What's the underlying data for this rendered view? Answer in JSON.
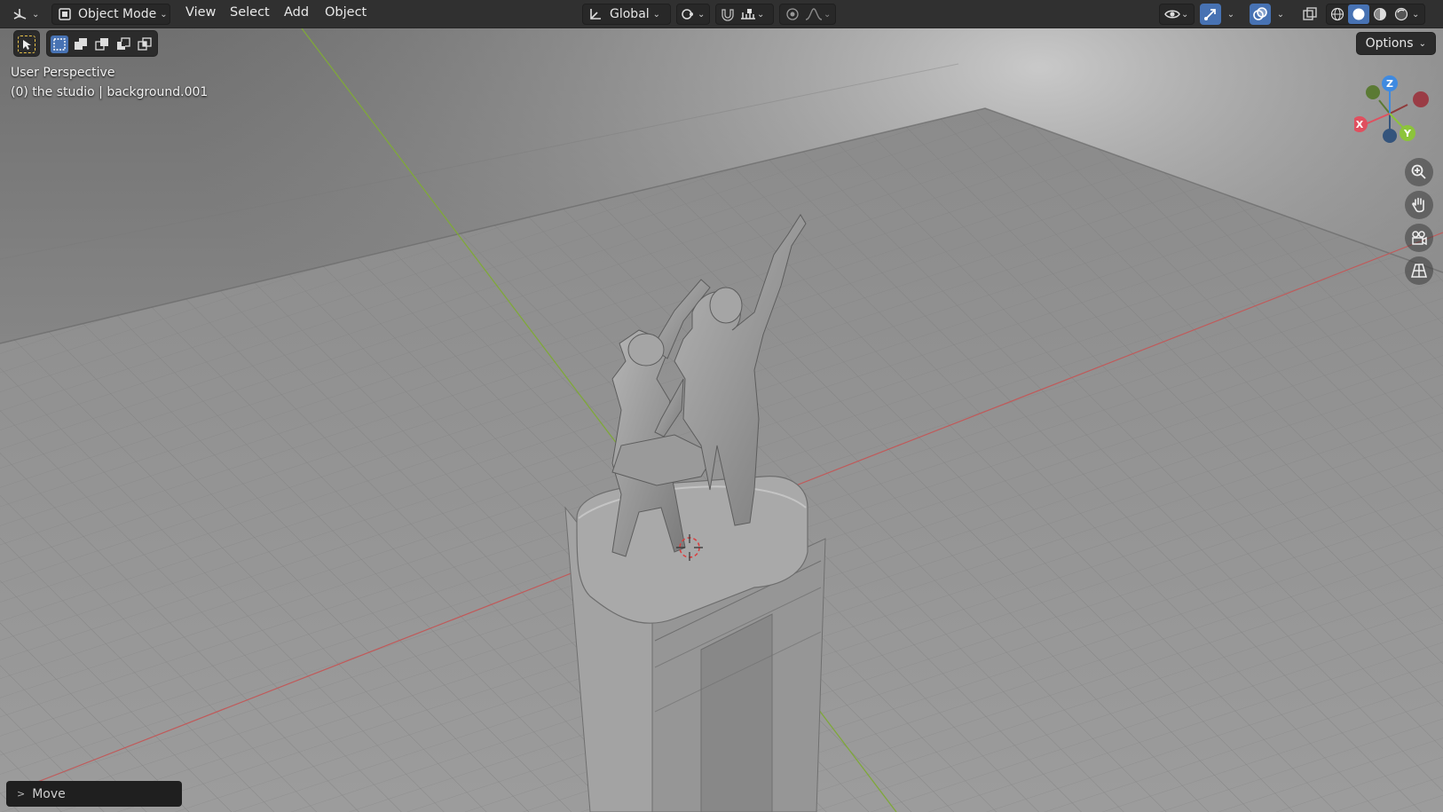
{
  "header": {
    "editor_type_icon": "3d-viewport-icon",
    "mode": {
      "label": "Object Mode",
      "icon": "object-mode-icon"
    },
    "menus": [
      "View",
      "Select",
      "Add",
      "Object"
    ],
    "transform_orientation": {
      "label": "Global",
      "icon": "orientation-global-icon"
    },
    "pivot_icon": "pivot-point-icon",
    "snap_icon": "snap-magnet-icon",
    "snap_target_icon": "snap-increment-icon",
    "proportional_icon": "proportional-edit-icon",
    "falloff_icon": "falloff-curve-icon",
    "visibility_icon": "eye-visibility-icon",
    "gizmo_icon": "gizmo-toggle-icon",
    "overlay_icon": "overlay-toggle-icon",
    "xray_icon": "xray-toggle-icon",
    "shading_modes": [
      "wireframe-shading-icon",
      "solid-shading-icon",
      "material-shading-icon",
      "rendered-shading-icon"
    ],
    "active_shading": "solid-shading-icon"
  },
  "toolbar": {
    "select_tool_icon": "select-box-tool-icon",
    "selection_modes": [
      "mode-set-icon",
      "mode-extend-icon",
      "mode-subtract-icon",
      "mode-invert-icon",
      "mode-intersect-icon"
    ],
    "options_label": "Options"
  },
  "viewport": {
    "view_name": "User Perspective",
    "context_line": "(0) the studio | background.001",
    "nav_gizmo": {
      "x": "X",
      "y": "Y",
      "z": "Z"
    },
    "nav_buttons": [
      "zoom-icon",
      "hand-pan-icon",
      "camera-view-icon",
      "orthographic-grid-icon"
    ]
  },
  "operator_panel": {
    "label": "Move"
  },
  "colors": {
    "header_bg": "#303030",
    "accent_blue": "#4772b3",
    "axis_x": "#e0505f",
    "axis_y": "#8cc43a",
    "axis_z": "#3f8ae0",
    "grid_floor": "#8a8a8a"
  }
}
